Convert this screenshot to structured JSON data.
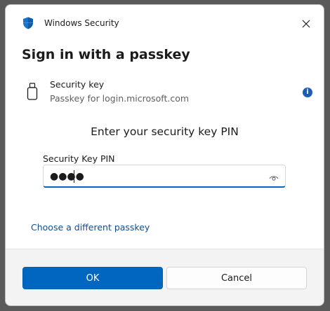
{
  "window": {
    "title": "Windows Security",
    "app_icon": "shield-icon",
    "close_icon": "close-icon"
  },
  "dialog": {
    "heading": "Sign in with a passkey",
    "key": {
      "icon": "usb-key-icon",
      "title": "Security key",
      "subtitle": "Passkey for login.microsoft.com",
      "info_icon": "info-icon",
      "info_glyph": "i"
    },
    "prompt": "Enter your security key PIN",
    "pin": {
      "label": "Security Key PIN",
      "masked_value": "●●●●",
      "reveal_icon": "eye-icon"
    },
    "alt_link": "Choose a different passkey"
  },
  "footer": {
    "ok_label": "OK",
    "cancel_label": "Cancel"
  },
  "colors": {
    "accent": "#0067c0",
    "link": "#0b4f8c",
    "footer_bg": "#f3f3f3",
    "info_badge": "#1a5fb4"
  }
}
